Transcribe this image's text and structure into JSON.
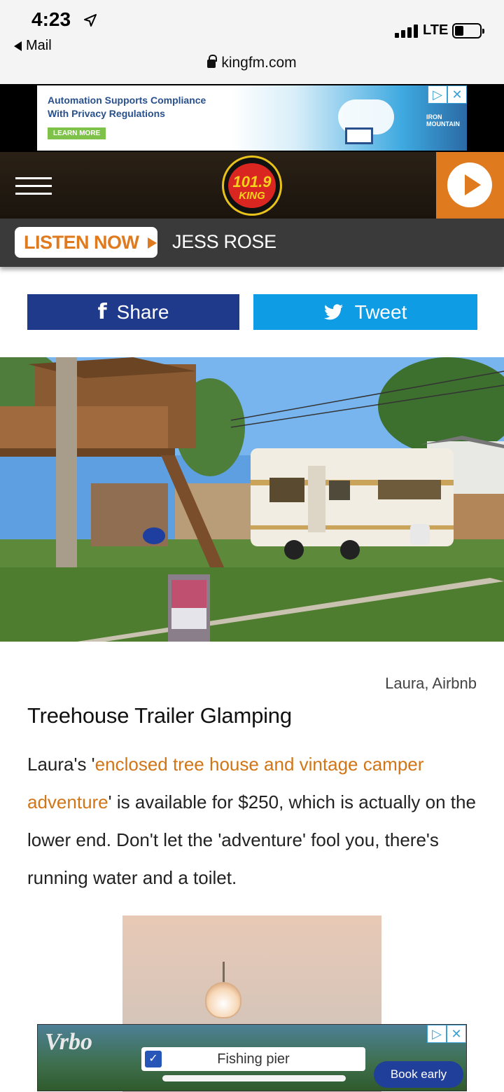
{
  "status_bar": {
    "time": "4:23",
    "back_app": "Mail",
    "carrier": "LTE",
    "url": "kingfm.com"
  },
  "top_ad": {
    "headline": "Automation Supports Compliance With Privacy Regulations",
    "cta": "LEARN MORE",
    "brand": "IRON MOUNTAIN",
    "choices_icon": "▷",
    "close_icon": "✕"
  },
  "header": {
    "logo_number": "101.9",
    "logo_name": "KING"
  },
  "listen_bar": {
    "listen_label": "LISTEN NOW",
    "dj": "JESS ROSE"
  },
  "social": {
    "share_label": "Share",
    "tweet_label": "Tweet"
  },
  "article": {
    "photo_credit": "Laura, Airbnb",
    "title": "Treehouse Trailer Glamping",
    "body_before": "Laura's '",
    "body_link": "enclosed tree house and vintage camper adventure",
    "body_after": "' is available for $250, which is actually on the lower end. Don't let the 'adventure' fool you, there's running water and a toilet."
  },
  "bottom_ad": {
    "brand": "Vrbo",
    "amenity": "Fishing pier",
    "checkbox_checked": true,
    "cta": "Book early",
    "choices_icon": "▷",
    "close_icon": "✕"
  }
}
